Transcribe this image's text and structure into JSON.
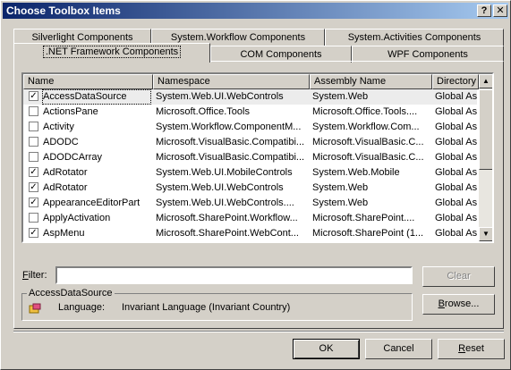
{
  "window": {
    "title": "Choose Toolbox Items",
    "help_label": "?",
    "close_label": "✕"
  },
  "tabs_row1": [
    "Silverlight Components",
    "System.Workflow Components",
    "System.Activities Components"
  ],
  "tabs_row2": [
    ".NET Framework Components",
    "COM Components",
    "WPF Components"
  ],
  "selected_tab": ".NET Framework Components",
  "list": {
    "columns": [
      "Name",
      "Namespace",
      "Assembly Name",
      "Directory"
    ],
    "rows": [
      {
        "checked": true,
        "name": "AccessDataSource",
        "namespace": "System.Web.UI.WebControls",
        "assembly": "System.Web",
        "directory": "Global Ass",
        "selected": true
      },
      {
        "checked": false,
        "name": "ActionsPane",
        "namespace": "Microsoft.Office.Tools",
        "assembly": "Microsoft.Office.Tools....",
        "directory": "Global Ass"
      },
      {
        "checked": false,
        "name": "Activity",
        "namespace": "System.Workflow.ComponentM...",
        "assembly": "System.Workflow.Com...",
        "directory": "Global Ass"
      },
      {
        "checked": false,
        "name": "ADODC",
        "namespace": "Microsoft.VisualBasic.Compatibi...",
        "assembly": "Microsoft.VisualBasic.C...",
        "directory": "Global Ass"
      },
      {
        "checked": false,
        "name": "ADODCArray",
        "namespace": "Microsoft.VisualBasic.Compatibi...",
        "assembly": "Microsoft.VisualBasic.C...",
        "directory": "Global Ass"
      },
      {
        "checked": true,
        "name": "AdRotator",
        "namespace": "System.Web.UI.MobileControls",
        "assembly": "System.Web.Mobile",
        "directory": "Global Ass"
      },
      {
        "checked": true,
        "name": "AdRotator",
        "namespace": "System.Web.UI.WebControls",
        "assembly": "System.Web",
        "directory": "Global Ass"
      },
      {
        "checked": true,
        "name": "AppearanceEditorPart",
        "namespace": "System.Web.UI.WebControls....",
        "assembly": "System.Web",
        "directory": "Global Ass"
      },
      {
        "checked": false,
        "name": "ApplyActivation",
        "namespace": "Microsoft.SharePoint.Workflow...",
        "assembly": "Microsoft.SharePoint....",
        "directory": "Global Ass"
      },
      {
        "checked": true,
        "name": "AspMenu",
        "namespace": "Microsoft.SharePoint.WebCont...",
        "assembly": "Microsoft.SharePoint (1...",
        "directory": "Global Ass"
      }
    ]
  },
  "filter": {
    "label": "Filter:",
    "value": "",
    "clear_label": "Clear"
  },
  "details": {
    "group_title": "AccessDataSource",
    "language_label": "Language:",
    "language_value": "Invariant Language (Invariant Country)",
    "browse_label": "Browse..."
  },
  "buttons": {
    "ok": "OK",
    "cancel": "Cancel",
    "reset": "Reset"
  }
}
